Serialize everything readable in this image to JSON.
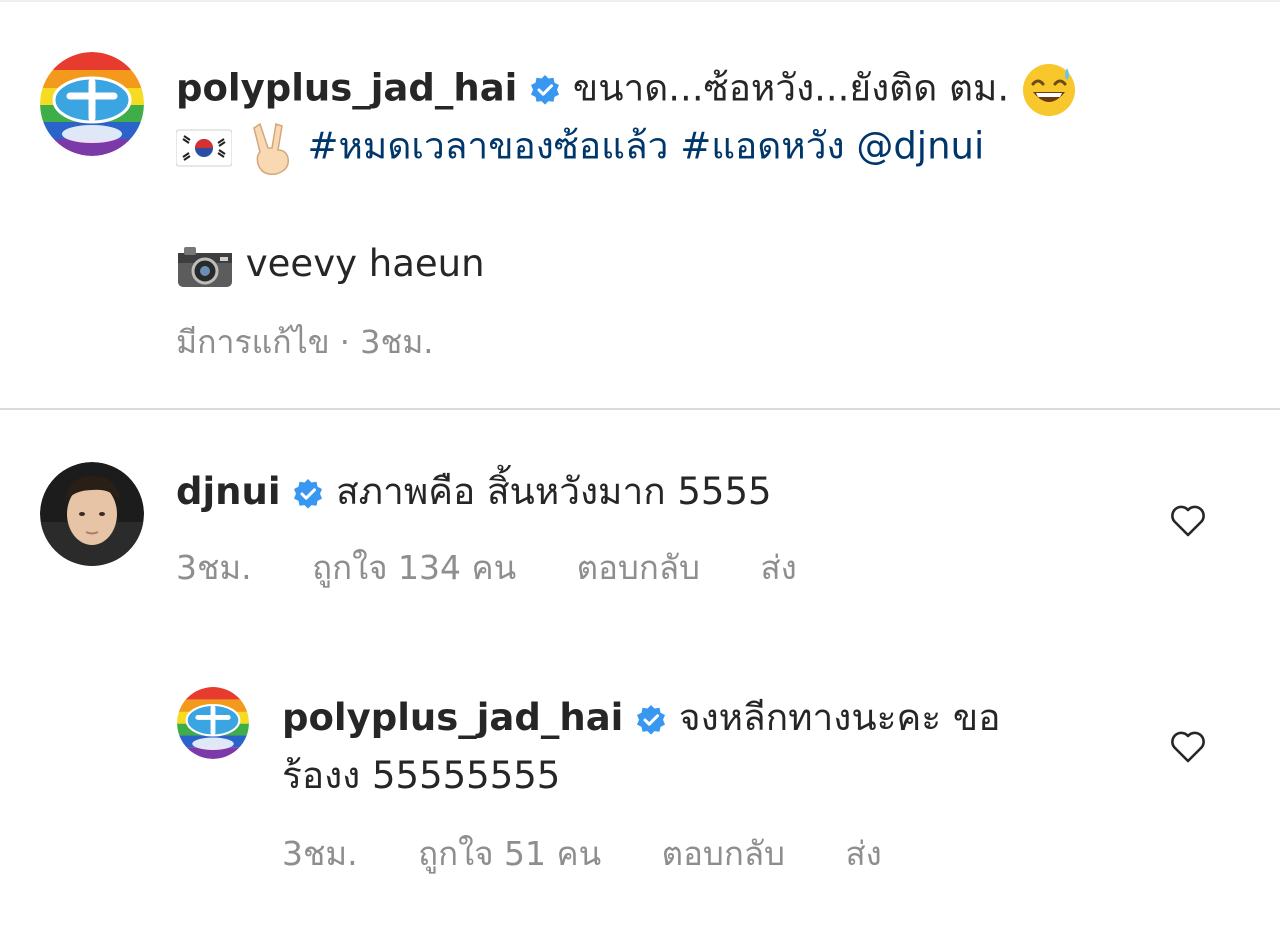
{
  "post": {
    "username": "polyplus_jad_hai",
    "caption_text": "ขนาด...ซ้อหวัง...ยังติด ตม.",
    "emoji_sweat": "😅",
    "emoji_flag": "🇰🇷",
    "emoji_peace": "✌🏻",
    "hashtag_1": "#หมดเวลาของซ้อแล้ว",
    "hashtag_2": "#แอดหวัง",
    "mention": "@djnui",
    "emoji_camera": "📷",
    "photo_credit": "veevy haeun",
    "edited_label": "มีการแก้ไข",
    "separator": "·",
    "time": "3ชม."
  },
  "comments": [
    {
      "username": "djnui",
      "text": "สภาพคือ สิ้นหวังมาก 5555",
      "time": "3ชม.",
      "likes_label": "ถูกใจ 134 คน",
      "reply_label": "ตอบกลับ",
      "send_label": "ส่ง"
    }
  ],
  "replies": [
    {
      "username": "polyplus_jad_hai",
      "text_line1": "จงหลีกทางนะคะ ขอ",
      "text_line2": "ร้องง 55555555",
      "time": "3ชม.",
      "likes_label": "ถูกใจ 51 คน",
      "reply_label": "ตอบกลับ",
      "send_label": "ส่ง"
    }
  ],
  "colors": {
    "verified_blue": "#3897f0",
    "link_blue": "#00376b",
    "meta_grey": "#8e8e8e"
  }
}
